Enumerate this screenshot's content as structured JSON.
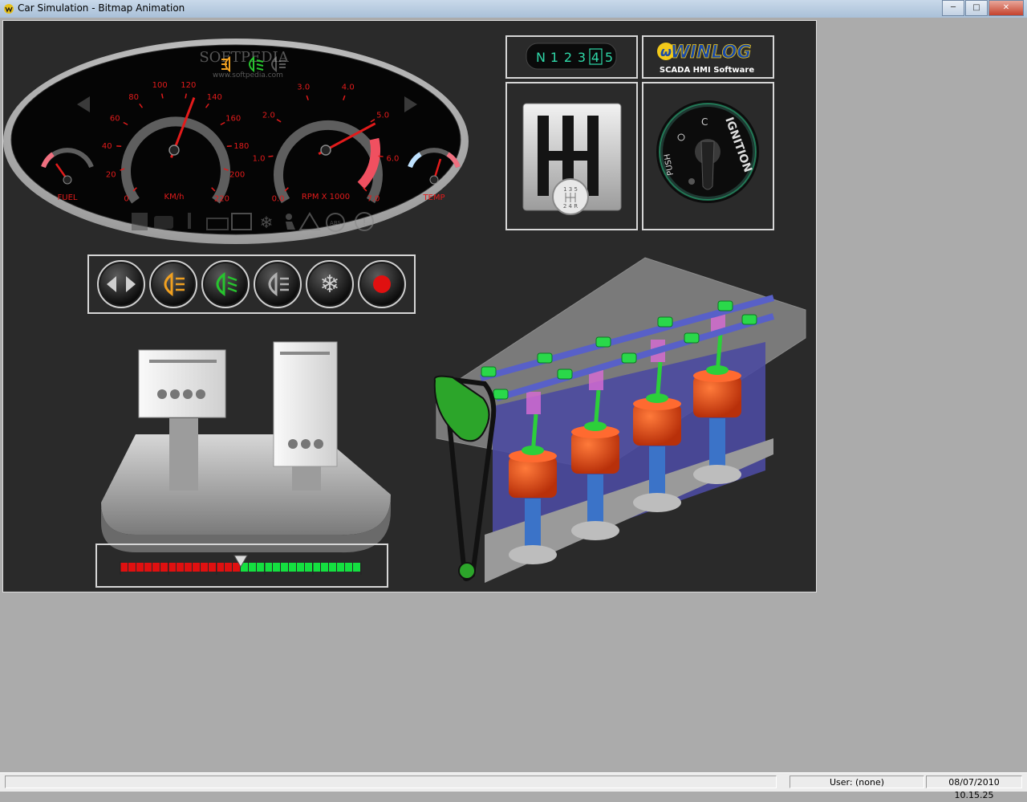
{
  "window": {
    "title": "Car Simulation - Bitmap Animation"
  },
  "dashboard": {
    "watermark": "SOFTPEDIA",
    "watermark_url": "www.softpedia.com",
    "speed_ticks": [
      "0",
      "20",
      "40",
      "60",
      "80",
      "100",
      "120",
      "140",
      "160",
      "180",
      "200",
      "220"
    ],
    "speed_label": "KM/h",
    "speed_value": 127,
    "rpm_ticks": [
      "0.0",
      "1.0",
      "2.0",
      "3.0",
      "4.0",
      "5.0",
      "6.0",
      "7.0"
    ],
    "rpm_label": "RPM X 1000",
    "rpm_value": 5.1,
    "fuel_label": "FUEL",
    "temp_label": "TEMP",
    "abs_label": "ABS"
  },
  "gear_display": {
    "gears": [
      "N",
      "1",
      "2",
      "3",
      "4",
      "5"
    ],
    "selected": "4"
  },
  "logo": {
    "name": "WINLOG",
    "subtitle": "SCADA HMI Software"
  },
  "shifter": {
    "knob_top": "1 3 5",
    "knob_bottom": "2 4 R"
  },
  "ignition": {
    "label": "IGNITION",
    "push_label": "PUSH"
  },
  "control_buttons": [
    {
      "name": "turn-signals-button",
      "icon": "arrows-icon",
      "color": "#d0d0d0"
    },
    {
      "name": "fog-light-button",
      "icon": "fog-light-icon",
      "color": "#f0a020"
    },
    {
      "name": "low-beam-button",
      "icon": "low-beam-icon",
      "color": "#27c42e"
    },
    {
      "name": "high-beam-button",
      "icon": "high-beam-icon",
      "color": "#b0b0b0"
    },
    {
      "name": "ac-button",
      "icon": "snowflake-icon",
      "color": "#d0d0d0"
    },
    {
      "name": "stop-button",
      "icon": "red-dot-icon",
      "color": "#e01010"
    }
  ],
  "throttle_bar": {
    "red_segments": 15,
    "green_segments": 15,
    "position": 0.5
  },
  "status": {
    "user": "User: (none)",
    "datetime": "08/07/2010  10.15.25"
  },
  "colors": {
    "accent_red": "#e21b1b",
    "panel_bg": "#2a2a2a",
    "green": "#26d13a"
  }
}
